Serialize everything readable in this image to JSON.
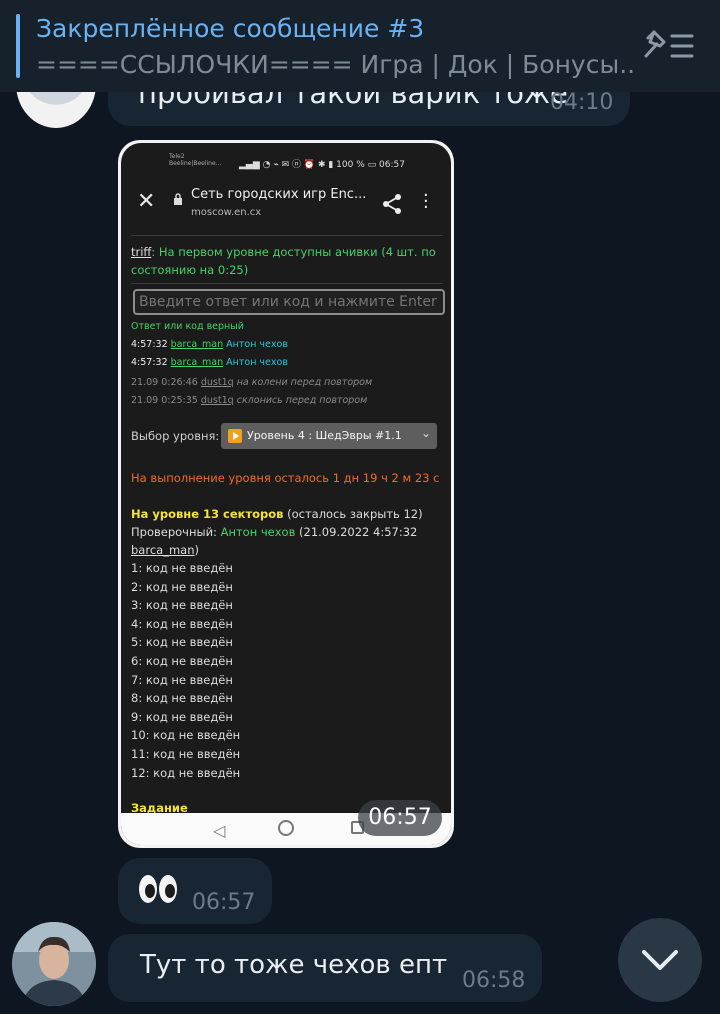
{
  "pinned": {
    "title": "Закреплённое сообщение #3",
    "text": "====ССЫЛОЧКИ==== Игра | Док | Бонусы..."
  },
  "messages": [
    {
      "text": "пробивал такой варик тоже",
      "time": "04:10"
    },
    {
      "type": "photo",
      "time": "06:57",
      "screenshot": {
        "status_carrier": [
          "Tele2",
          "Beeline|Beeline..."
        ],
        "status_icons": "100 %",
        "status_time": "06:57",
        "browser_title": "Сеть городских игр Enc...",
        "browser_url": "moscow.en.cx",
        "chat_user": "triff",
        "chat_text": ": На первом уровне доступны ачивки (4 шт. по",
        "chat_text2": "состоянию на 0:25)",
        "input_placeholder": "Введите ответ или код и нажмите Enter",
        "answer_status": "Ответ или код верный",
        "log": [
          {
            "time": "4:57:32",
            "user": "barca_man",
            "code": "Антон чехов"
          },
          {
            "time": "4:57:32",
            "user": "barca_man",
            "code": "Антон чехов"
          },
          {
            "time": "21.09 0:26:46",
            "user": "dust1q",
            "code": "на колени перед повтором"
          },
          {
            "time": "21.09 0:25:35",
            "user": "dust1q",
            "code": "склонись перед повтором"
          }
        ],
        "level_label": "Выбор уровня:",
        "level_value": "Уровень 4 : ШедЭвры #1.1",
        "time_left": "На выполнение уровня осталось 1 дн 19 ч 2 м 23 с",
        "sectors_title": "На уровне 13 секторов",
        "sectors_remaining": " (осталось закрыть 12)",
        "check_label": "Проверочный: ",
        "check_value": "Антон чехов",
        "check_meta": " (21.09.2022 4:57:32",
        "check_user": "barca_man",
        "check_close": ")",
        "sectors": [
          "1: код не введён",
          "2: код не введён",
          "3: код не введён",
          "4: код не введён",
          "5: код не введён",
          "6: код не введён",
          "7: код не введён",
          "8: код не введён",
          "9: код не введён",
          "10: код не введён",
          "11: код не введён",
          "12: код не введён"
        ],
        "task_label": "Задание"
      }
    },
    {
      "text": "👀",
      "time": "06:57"
    },
    {
      "text": "Тут то тоже чехов епт",
      "time": "06:58"
    }
  ],
  "icons": {
    "pin_list": "unpin-list-icon",
    "scroll_down": "chevron-down-icon"
  },
  "colors": {
    "background": "#0e1621",
    "bubble": "#182533",
    "accent": "#6ab2f2"
  }
}
